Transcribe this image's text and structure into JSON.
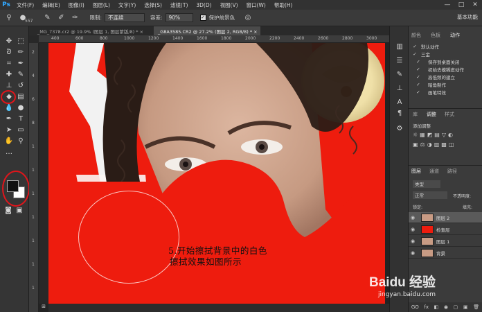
{
  "app": {
    "logo": "Ps"
  },
  "menu": [
    "文件(F)",
    "编辑(E)",
    "图像(I)",
    "图层(L)",
    "文字(Y)",
    "选择(S)",
    "滤镜(T)",
    "3D(D)",
    "视图(V)",
    "窗口(W)",
    "帮助(H)"
  ],
  "window_controls": {
    "minimize": "—",
    "maximize": "□",
    "close": "✕"
  },
  "options_bar": {
    "brush_size": "557",
    "limits_label": "限制:",
    "limits_value": "不连续",
    "tolerance_label": "容差:",
    "tolerance_value": "90%",
    "protect_fg_label": "保护前景色",
    "workspace": "基本功能"
  },
  "tabs": [
    {
      "label": "_MG_7378.cr2 @ 19.9% (图层 1, 图层蒙版/8) *",
      "close": "×"
    },
    {
      "label": "_G8A3585.CR2 @ 27.2% (图层 2, RGB/8) *",
      "close": "×"
    }
  ],
  "ruler": {
    "h": [
      "400",
      "600",
      "800",
      "1000",
      "1200",
      "1400",
      "1600",
      "1800",
      "2000",
      "2200",
      "2400",
      "2600",
      "2800",
      "3000"
    ],
    "v": [
      "2",
      "4",
      "6",
      "8",
      "1",
      "1",
      "1",
      "1",
      "1",
      "1",
      "1"
    ]
  },
  "right_panel": {
    "top_tabs": [
      "颜色",
      "色板",
      "动作"
    ],
    "actions": [
      "默认动作",
      "三金",
      "保存到桌面关闭",
      "初始去模糊皮动作",
      "高低频的建立",
      "暗角制作",
      "画笔特效"
    ],
    "mid_tabs": [
      "库",
      "调整",
      "样式"
    ],
    "adjust_label": "添加调整",
    "layer_tabs": [
      "图层",
      "通道",
      "路径"
    ],
    "kind_label": "类型",
    "blend_mode": "正常",
    "opacity_label": "不透明度:",
    "lock_label": "锁定:",
    "fill_label": "填充:",
    "layers": [
      {
        "name": "图层 2",
        "thumb": "#c89b84"
      },
      {
        "name": "检查层",
        "thumb": "#ee1c0e"
      },
      {
        "name": "图层 1",
        "thumb": "#c89b84"
      },
      {
        "name": "背景",
        "thumb": "#c89b84"
      }
    ],
    "footer_icons": [
      "GO",
      "fx",
      "◧",
      "◉",
      "▢",
      "▣",
      "🗑"
    ]
  },
  "caption": {
    "line1": "5.开始擦拭背景中的白色",
    "line2": "擦拭效果如图所示"
  },
  "watermark": {
    "brand": "Baidu 经验",
    "url": "jingyan.baidu.com"
  },
  "colors": {
    "canvas_red": "#ee1c0e",
    "annotation_red": "#e0151b",
    "ps_blue": "#31a8ff"
  }
}
